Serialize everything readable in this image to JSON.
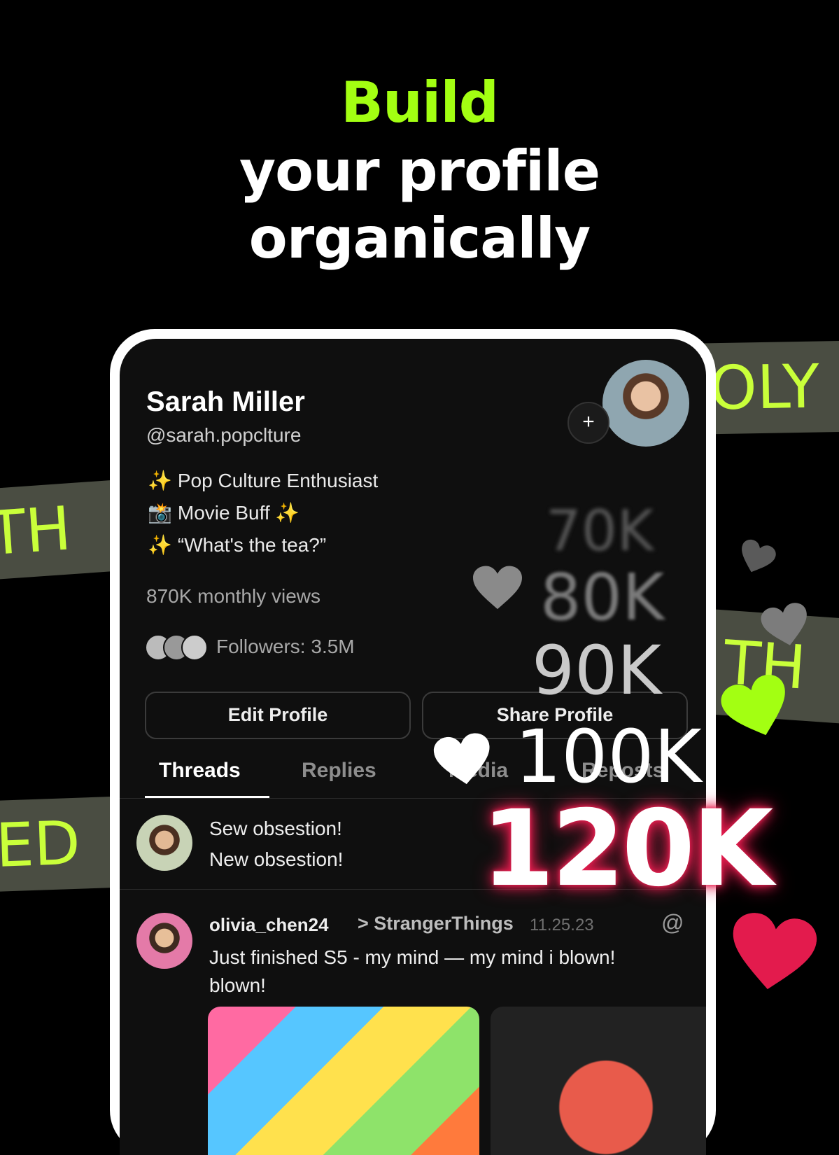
{
  "headline": {
    "line1": "Build",
    "line2": "your profile",
    "line3": "organically"
  },
  "tapes": [
    "OLY",
    "TH",
    "TH",
    "ED"
  ],
  "profile": {
    "name": "Sarah Miller",
    "handle": "@sarah.popclture",
    "bio": [
      {
        "icon": "sparkle-icon",
        "emoji": "✨",
        "text": "Pop Culture Enthusiast"
      },
      {
        "icon": "camera-icon",
        "emoji": "📸",
        "text": "Movie Buff ✨"
      },
      {
        "icon": "sparkle-icon",
        "emoji": "✨",
        "text": "“What's the tea?”"
      }
    ],
    "views": "870K monthly views",
    "followers": "Followers: 3.5M",
    "add_symbol": "+"
  },
  "buttons": {
    "edit": "Edit Profile",
    "share": "Share Profile"
  },
  "tabs": [
    {
      "label": "Threads",
      "active": true
    },
    {
      "label": "Replies",
      "active": false
    },
    {
      "label": "Media",
      "active": false
    },
    {
      "label": "Reposts",
      "active": false
    }
  ],
  "posts": [
    {
      "lines": [
        "Sew obsestion!",
        "New obsestion!"
      ]
    },
    {
      "user": "olivia_chen24",
      "tag": "> StrangerThings",
      "date": "11.25.23",
      "text": "Just finished S5 - my mind — my mind i blown! blown!"
    }
  ],
  "counters": [
    "70K",
    "80K",
    "90K",
    "100K",
    "120K"
  ],
  "colors": {
    "accent_green": "#a3ff12",
    "heart_red": "#e31b4d",
    "background": "#000000"
  }
}
